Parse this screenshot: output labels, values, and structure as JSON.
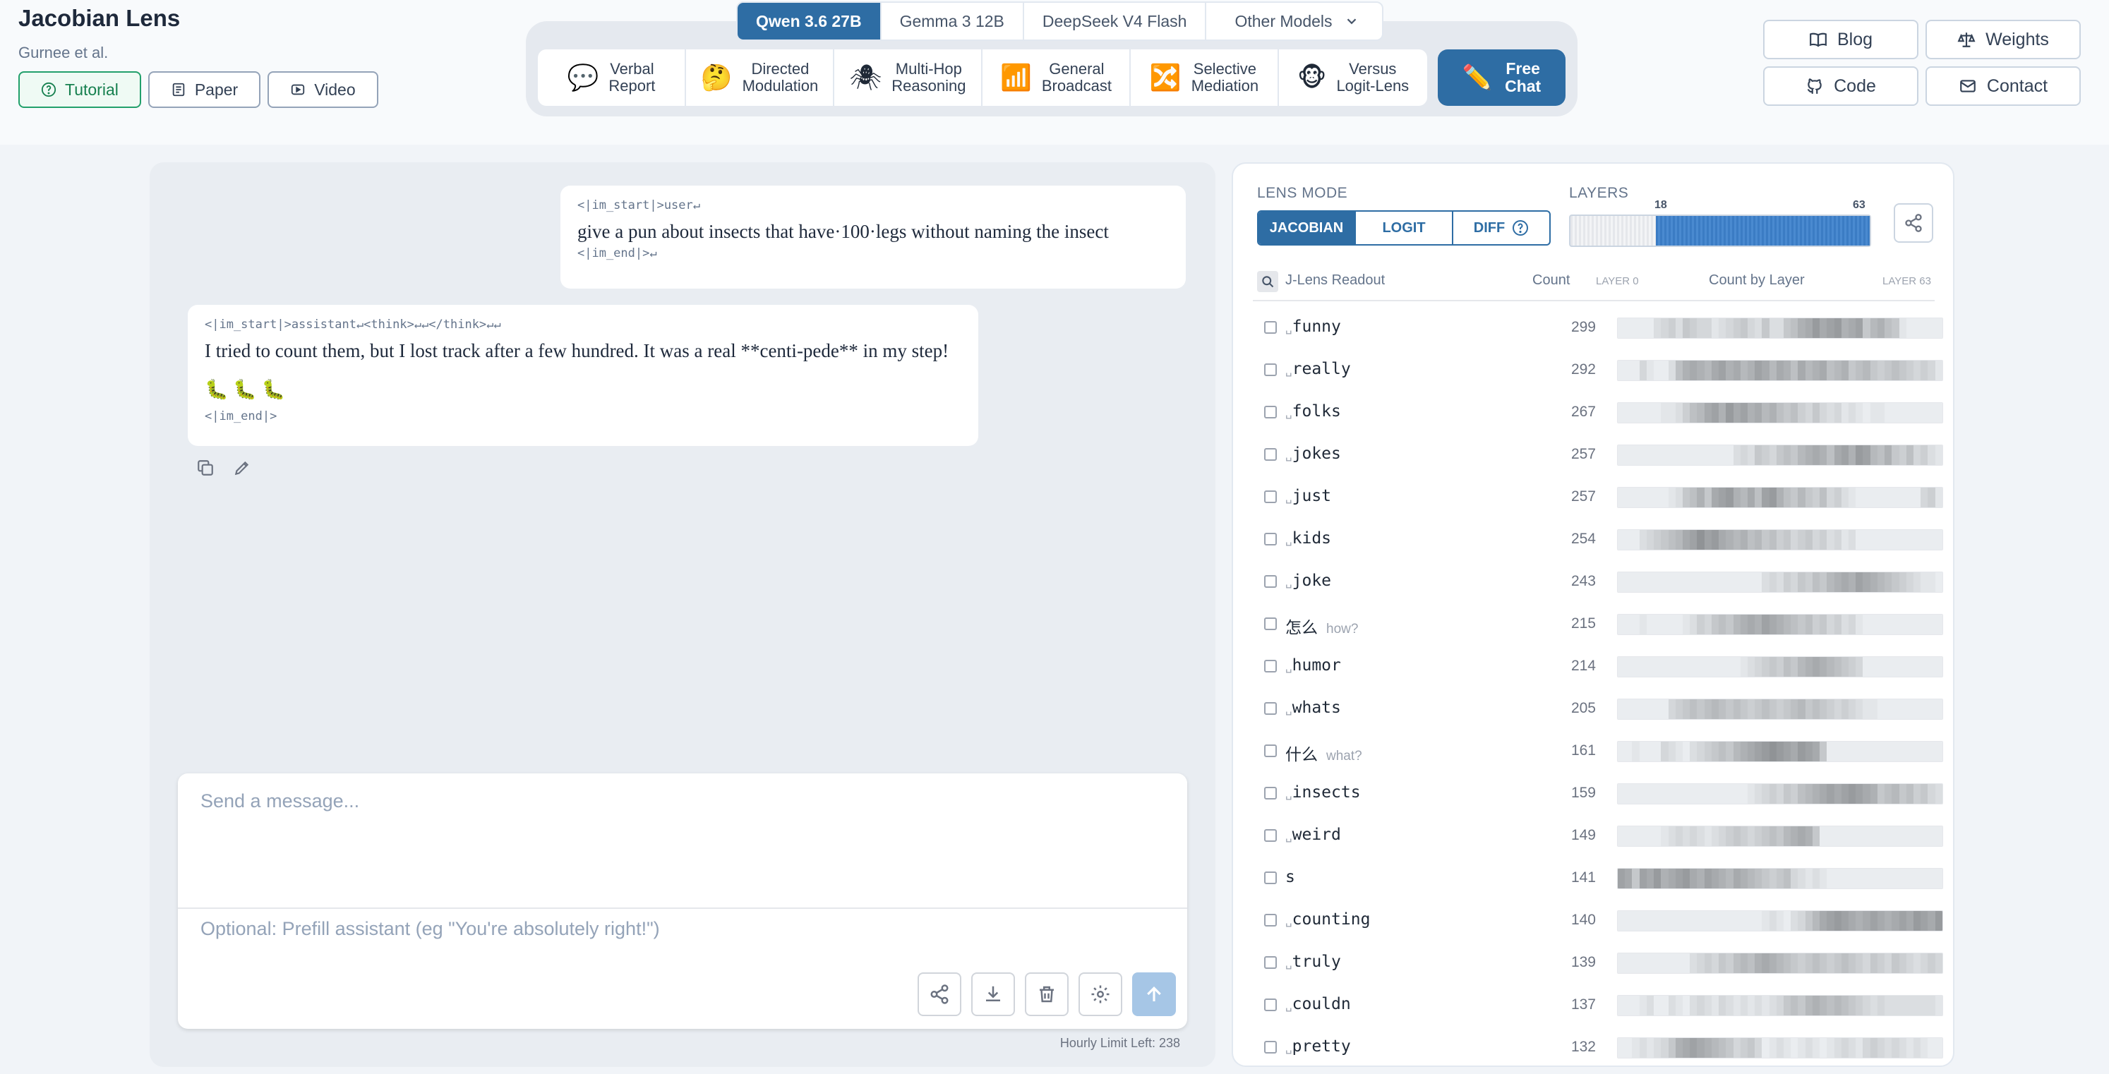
{
  "brand": {
    "title": "Jacobian Lens",
    "subtitle": "Gurnee et al."
  },
  "brand_links": [
    {
      "label": "Tutorial",
      "icon": "help-circle-icon",
      "active": true
    },
    {
      "label": "Paper",
      "icon": "document-icon",
      "active": false
    },
    {
      "label": "Video",
      "icon": "video-icon",
      "active": false
    }
  ],
  "models": [
    {
      "label": "Qwen 3.6 27B",
      "active": true
    },
    {
      "label": "Gemma 3 12B",
      "active": false
    },
    {
      "label": "DeepSeek V4 Flash",
      "active": false
    },
    {
      "label": "Other Models",
      "active": false
    }
  ],
  "features": [
    {
      "l1": "Verbal",
      "l2": "Report",
      "icon": "💬",
      "icon_name": "speech-bubble-icon"
    },
    {
      "l1": "Directed",
      "l2": "Modulation",
      "icon": "🤔",
      "icon_name": "thinking-face-icon"
    },
    {
      "l1": "Multi-Hop",
      "l2": "Reasoning",
      "icon": "🕷",
      "icon_name": "spider-icon"
    },
    {
      "l1": "General",
      "l2": "Broadcast",
      "icon": "📶",
      "icon_name": "broadcast-icon"
    },
    {
      "l1": "Selective",
      "l2": "Mediation",
      "icon": "🔀",
      "icon_name": "shuffle-icon"
    },
    {
      "l1": "Versus",
      "l2": "Logit-Lens",
      "icon": "🐵",
      "icon_name": "monkeys-icon"
    }
  ],
  "free_chat": {
    "l1": "Free",
    "l2": "Chat",
    "icon": "✏️"
  },
  "right_links": [
    {
      "label": "Blog",
      "icon": "book-icon"
    },
    {
      "label": "Weights",
      "icon": "scale-icon"
    },
    {
      "label": "Code",
      "icon": "github-icon"
    },
    {
      "label": "Contact",
      "icon": "mail-icon"
    }
  ],
  "chat": {
    "user": {
      "start": "<|im_start|>user↵",
      "text": "give a pun about insects that have·100·legs without naming the insect",
      "end": "<|im_end|>↵"
    },
    "assistant": {
      "start": "<|im_start|>assistant↵<think>↵↵</think>↵↵",
      "text": "I tried to count them, but I lost track after a few hundred. It was a real **centi-pede** in my step! 🐛 🐛 🐛",
      "end": "<|im_end|>"
    },
    "message_placeholder": "Send a message...",
    "prefill_placeholder": "Optional: Prefill assistant (eg \"You're absolutely right!\")",
    "limit": "Hourly Limit Left: 238"
  },
  "lens": {
    "mode_label": "LENS MODE",
    "modes": [
      {
        "label": "JACOBIAN",
        "active": true
      },
      {
        "label": "LOGIT",
        "active": false
      },
      {
        "label": "DIFF",
        "active": false
      }
    ],
    "layers_label": "LAYERS",
    "layer_min": 0,
    "layer_max": 63,
    "layer_from": 18,
    "layer_to": 63,
    "layer_from_label": "18",
    "layer_to_label": "63",
    "readout_title": "J-Lens Readout",
    "count_title": "Count",
    "layer0": "LAYER 0",
    "count_by_layer": "Count by Layer",
    "layer63": "LAYER 63",
    "rows": [
      {
        "token": "funny",
        "space": true,
        "gloss": "",
        "count": "299",
        "heat": [
          0.05,
          0.05,
          0.05,
          0.05,
          0.05,
          0.15,
          0.2,
          0.25,
          0.15,
          0.3,
          0.25,
          0.2,
          0.2,
          0.1,
          0.15,
          0.2,
          0.25,
          0.3,
          0.2,
          0.15,
          0.3,
          0.15,
          0.15,
          0.3,
          0.35,
          0.45,
          0.5,
          0.6,
          0.5,
          0.55,
          0.6,
          0.45,
          0.5,
          0.55,
          0.3,
          0.4,
          0.45,
          0.35,
          0.3,
          0.1,
          0.05,
          0.05,
          0.05,
          0.05,
          0.05
        ]
      },
      {
        "token": "really",
        "space": true,
        "gloss": "",
        "count": "292",
        "heat": [
          0.05,
          0.05,
          0.05,
          0.2,
          0.1,
          0.05,
          0.05,
          0.15,
          0.35,
          0.45,
          0.5,
          0.45,
          0.4,
          0.5,
          0.55,
          0.45,
          0.5,
          0.4,
          0.45,
          0.55,
          0.5,
          0.4,
          0.5,
          0.45,
          0.35,
          0.5,
          0.4,
          0.45,
          0.5,
          0.35,
          0.4,
          0.45,
          0.3,
          0.35,
          0.4,
          0.3,
          0.25,
          0.3,
          0.35,
          0.3,
          0.25,
          0.2,
          0.25,
          0.2,
          0.1
        ]
      },
      {
        "token": "folks",
        "space": true,
        "gloss": "",
        "count": "267",
        "heat": [
          0.05,
          0.05,
          0.05,
          0.05,
          0.05,
          0.05,
          0.1,
          0.1,
          0.15,
          0.25,
          0.35,
          0.4,
          0.5,
          0.55,
          0.45,
          0.6,
          0.5,
          0.55,
          0.45,
          0.5,
          0.4,
          0.45,
          0.35,
          0.3,
          0.35,
          0.25,
          0.2,
          0.3,
          0.2,
          0.15,
          0.2,
          0.1,
          0.15,
          0.1,
          0.05,
          0.1,
          0.1,
          0.05,
          0.05,
          0.05,
          0.05,
          0.05,
          0.05,
          0.05,
          0.05
        ]
      },
      {
        "token": "jokes",
        "space": true,
        "gloss": "",
        "count": "257",
        "heat": [
          0.05,
          0.05,
          0.05,
          0.05,
          0.05,
          0.05,
          0.05,
          0.05,
          0.05,
          0.05,
          0.05,
          0.05,
          0.05,
          0.05,
          0.05,
          0.05,
          0.15,
          0.2,
          0.15,
          0.3,
          0.25,
          0.2,
          0.3,
          0.35,
          0.3,
          0.4,
          0.45,
          0.5,
          0.45,
          0.35,
          0.5,
          0.55,
          0.45,
          0.6,
          0.55,
          0.4,
          0.35,
          0.45,
          0.3,
          0.25,
          0.35,
          0.2,
          0.25,
          0.15,
          0.1
        ]
      },
      {
        "token": "just",
        "space": true,
        "gloss": "",
        "count": "257",
        "heat": [
          0.05,
          0.05,
          0.05,
          0.05,
          0.05,
          0.05,
          0.05,
          0.1,
          0.15,
          0.3,
          0.35,
          0.45,
          0.3,
          0.5,
          0.55,
          0.6,
          0.45,
          0.4,
          0.5,
          0.35,
          0.55,
          0.6,
          0.45,
          0.35,
          0.3,
          0.4,
          0.3,
          0.25,
          0.35,
          0.2,
          0.25,
          0.15,
          0.1,
          0.05,
          0.05,
          0.05,
          0.05,
          0.05,
          0.05,
          0.05,
          0.05,
          0.05,
          0.2,
          0.25,
          0.1
        ]
      },
      {
        "token": "kids",
        "space": true,
        "gloss": "",
        "count": "254",
        "heat": [
          0.05,
          0.05,
          0.05,
          0.15,
          0.2,
          0.25,
          0.3,
          0.35,
          0.4,
          0.5,
          0.55,
          0.65,
          0.55,
          0.6,
          0.5,
          0.45,
          0.4,
          0.45,
          0.35,
          0.4,
          0.3,
          0.35,
          0.25,
          0.3,
          0.2,
          0.25,
          0.3,
          0.2,
          0.25,
          0.15,
          0.2,
          0.1,
          0.15,
          0.05,
          0.05,
          0.05,
          0.05,
          0.05,
          0.05,
          0.05,
          0.05,
          0.05,
          0.05,
          0.05,
          0.05
        ]
      },
      {
        "token": "joke",
        "space": true,
        "gloss": "",
        "count": "243",
        "heat": [
          0.05,
          0.05,
          0.05,
          0.05,
          0.05,
          0.05,
          0.05,
          0.05,
          0.05,
          0.05,
          0.05,
          0.05,
          0.05,
          0.05,
          0.05,
          0.05,
          0.05,
          0.05,
          0.05,
          0.05,
          0.15,
          0.2,
          0.15,
          0.25,
          0.2,
          0.3,
          0.25,
          0.35,
          0.3,
          0.4,
          0.45,
          0.5,
          0.45,
          0.55,
          0.5,
          0.45,
          0.4,
          0.35,
          0.3,
          0.25,
          0.2,
          0.15,
          0.1,
          0.1,
          0.05
        ]
      },
      {
        "token": "怎么",
        "space": false,
        "gloss": "how?",
        "count": "215",
        "heat": [
          0.05,
          0.05,
          0.05,
          0.1,
          0.05,
          0.05,
          0.05,
          0.05,
          0.05,
          0.1,
          0.15,
          0.25,
          0.2,
          0.3,
          0.35,
          0.3,
          0.4,
          0.45,
          0.5,
          0.45,
          0.55,
          0.5,
          0.45,
          0.4,
          0.35,
          0.3,
          0.35,
          0.25,
          0.3,
          0.2,
          0.25,
          0.15,
          0.2,
          0.1,
          0.05,
          0.05,
          0.05,
          0.05,
          0.05,
          0.05,
          0.05,
          0.05,
          0.05,
          0.05,
          0.05
        ]
      },
      {
        "token": "humor",
        "space": true,
        "gloss": "",
        "count": "214",
        "heat": [
          0.05,
          0.05,
          0.05,
          0.05,
          0.05,
          0.05,
          0.05,
          0.05,
          0.05,
          0.05,
          0.05,
          0.05,
          0.05,
          0.05,
          0.05,
          0.05,
          0.05,
          0.1,
          0.15,
          0.2,
          0.25,
          0.3,
          0.25,
          0.35,
          0.3,
          0.4,
          0.45,
          0.5,
          0.45,
          0.4,
          0.35,
          0.3,
          0.25,
          0.2,
          0.05,
          0.05,
          0.05,
          0.05,
          0.05,
          0.05,
          0.05,
          0.05,
          0.05,
          0.05,
          0.05
        ]
      },
      {
        "token": "whats",
        "space": true,
        "gloss": "",
        "count": "205",
        "heat": [
          0.05,
          0.05,
          0.05,
          0.05,
          0.05,
          0.05,
          0.05,
          0.2,
          0.25,
          0.3,
          0.35,
          0.3,
          0.35,
          0.4,
          0.35,
          0.3,
          0.35,
          0.3,
          0.25,
          0.3,
          0.35,
          0.3,
          0.25,
          0.3,
          0.35,
          0.4,
          0.3,
          0.35,
          0.3,
          0.25,
          0.2,
          0.25,
          0.2,
          0.15,
          0.1,
          0.1,
          0.05,
          0.05,
          0.05,
          0.05,
          0.05,
          0.05,
          0.05,
          0.05,
          0.05
        ]
      },
      {
        "token": "什么",
        "space": false,
        "gloss": "what?",
        "count": "161",
        "heat": [
          0.05,
          0.05,
          0.1,
          0.05,
          0.05,
          0.05,
          0.2,
          0.15,
          0.1,
          0.05,
          0.15,
          0.2,
          0.25,
          0.3,
          0.35,
          0.3,
          0.4,
          0.45,
          0.5,
          0.55,
          0.6,
          0.65,
          0.6,
          0.55,
          0.5,
          0.6,
          0.55,
          0.5,
          0.3,
          0.05,
          0.05,
          0.05,
          0.05,
          0.05,
          0.05,
          0.05,
          0.05,
          0.05,
          0.05,
          0.05,
          0.05,
          0.05,
          0.05,
          0.05,
          0.05
        ]
      },
      {
        "token": "insects",
        "space": true,
        "gloss": "",
        "count": "159",
        "heat": [
          0.05,
          0.05,
          0.05,
          0.05,
          0.05,
          0.05,
          0.05,
          0.05,
          0.05,
          0.05,
          0.05,
          0.05,
          0.05,
          0.05,
          0.05,
          0.05,
          0.05,
          0.05,
          0.1,
          0.15,
          0.2,
          0.25,
          0.2,
          0.3,
          0.25,
          0.35,
          0.4,
          0.45,
          0.5,
          0.55,
          0.5,
          0.55,
          0.6,
          0.55,
          0.5,
          0.45,
          0.3,
          0.35,
          0.4,
          0.3,
          0.35,
          0.25,
          0.3,
          0.2,
          0.15
        ]
      },
      {
        "token": "weird",
        "space": true,
        "gloss": "",
        "count": "149",
        "heat": [
          0.05,
          0.05,
          0.05,
          0.05,
          0.05,
          0.05,
          0.1,
          0.15,
          0.2,
          0.15,
          0.2,
          0.15,
          0.1,
          0.15,
          0.2,
          0.25,
          0.3,
          0.25,
          0.2,
          0.25,
          0.3,
          0.35,
          0.3,
          0.4,
          0.45,
          0.5,
          0.45,
          0.3,
          0.05,
          0.05,
          0.05,
          0.05,
          0.05,
          0.05,
          0.05,
          0.05,
          0.05,
          0.05,
          0.05,
          0.05,
          0.05,
          0.05,
          0.05,
          0.05,
          0.05
        ]
      },
      {
        "token": "s",
        "space": false,
        "gloss": "",
        "count": "141",
        "heat": [
          0.55,
          0.5,
          0.3,
          0.55,
          0.5,
          0.6,
          0.45,
          0.5,
          0.55,
          0.6,
          0.5,
          0.45,
          0.55,
          0.5,
          0.45,
          0.4,
          0.5,
          0.45,
          0.4,
          0.35,
          0.3,
          0.25,
          0.3,
          0.35,
          0.2,
          0.15,
          0.1,
          0.15,
          0.1,
          0.05,
          0.05,
          0.05,
          0.05,
          0.05,
          0.05,
          0.05,
          0.05,
          0.05,
          0.05,
          0.05,
          0.05,
          0.05,
          0.05,
          0.05,
          0.05
        ]
      },
      {
        "token": "counting",
        "space": true,
        "gloss": "",
        "count": "140",
        "heat": [
          0.05,
          0.05,
          0.05,
          0.05,
          0.05,
          0.05,
          0.05,
          0.05,
          0.05,
          0.05,
          0.05,
          0.05,
          0.05,
          0.05,
          0.05,
          0.05,
          0.05,
          0.05,
          0.05,
          0.05,
          0.1,
          0.15,
          0.1,
          0.05,
          0.15,
          0.2,
          0.3,
          0.4,
          0.5,
          0.55,
          0.6,
          0.55,
          0.5,
          0.45,
          0.5,
          0.55,
          0.5,
          0.45,
          0.5,
          0.55,
          0.5,
          0.6,
          0.55,
          0.5,
          0.6
        ]
      },
      {
        "token": "truly",
        "space": true,
        "gloss": "",
        "count": "139",
        "heat": [
          0.05,
          0.05,
          0.05,
          0.05,
          0.05,
          0.05,
          0.05,
          0.05,
          0.05,
          0.05,
          0.15,
          0.2,
          0.25,
          0.2,
          0.3,
          0.25,
          0.35,
          0.4,
          0.35,
          0.45,
          0.5,
          0.45,
          0.4,
          0.35,
          0.3,
          0.25,
          0.3,
          0.35,
          0.3,
          0.25,
          0.3,
          0.35,
          0.3,
          0.25,
          0.2,
          0.3,
          0.25,
          0.2,
          0.3,
          0.25,
          0.2,
          0.15,
          0.2,
          0.25,
          0.2
        ]
      },
      {
        "token": "couldn",
        "space": true,
        "gloss": "",
        "count": "137",
        "heat": [
          0.05,
          0.05,
          0.05,
          0.1,
          0.15,
          0.05,
          0.05,
          0.15,
          0.1,
          0.05,
          0.15,
          0.2,
          0.15,
          0.1,
          0.2,
          0.15,
          0.1,
          0.15,
          0.1,
          0.15,
          0.1,
          0.15,
          0.2,
          0.3,
          0.35,
          0.3,
          0.4,
          0.45,
          0.4,
          0.35,
          0.4,
          0.35,
          0.3,
          0.25,
          0.2,
          0.15,
          0.2,
          0.15,
          0.15,
          0.15,
          0.15,
          0.15,
          0.15,
          0.15,
          0.1
        ]
      },
      {
        "token": "pretty",
        "space": true,
        "gloss": "",
        "count": "132",
        "heat": [
          0.05,
          0.05,
          0.1,
          0.15,
          0.1,
          0.15,
          0.2,
          0.3,
          0.45,
          0.5,
          0.55,
          0.5,
          0.45,
          0.4,
          0.35,
          0.3,
          0.2,
          0.25,
          0.3,
          0.2,
          0.05,
          0.1,
          0.15,
          0.1,
          0.05,
          0.1,
          0.15,
          0.1,
          0.05,
          0.1,
          0.15,
          0.2,
          0.15,
          0.1,
          0.2,
          0.25,
          0.2,
          0.15,
          0.2,
          0.15,
          0.1,
          0.15,
          0.1,
          0.05,
          0.05
        ]
      }
    ]
  }
}
